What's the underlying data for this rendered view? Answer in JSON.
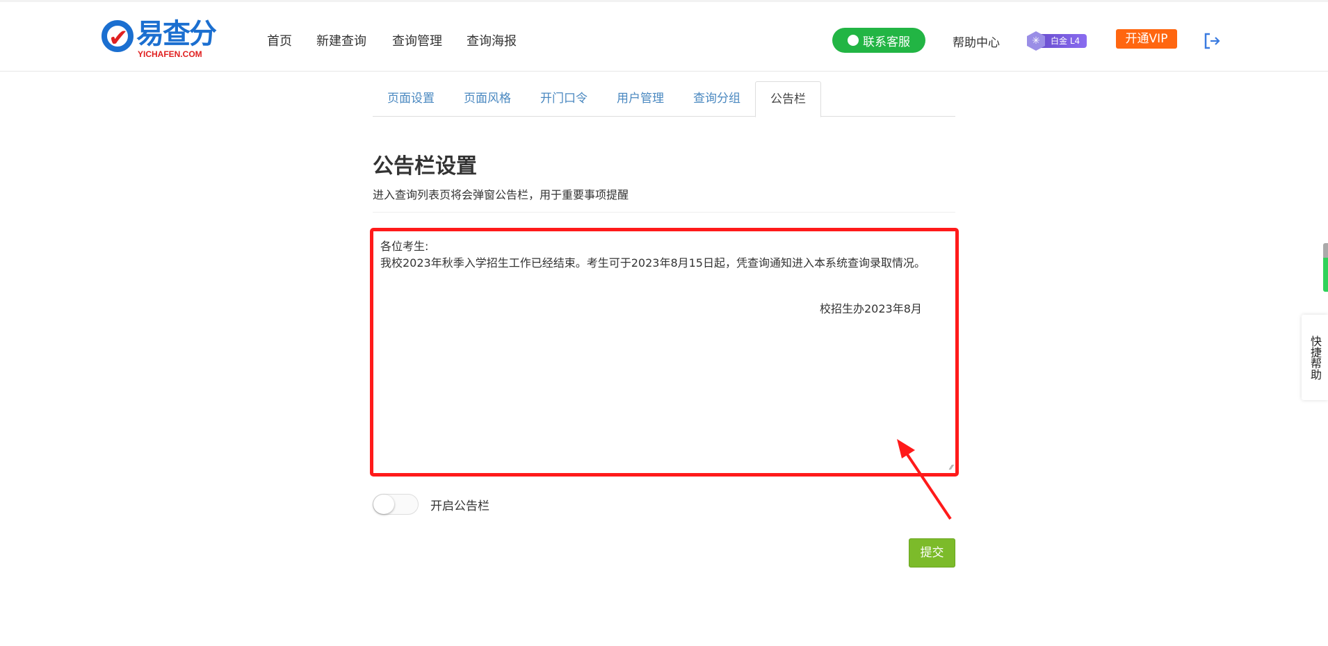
{
  "header": {
    "logo": {
      "cn": "易查分",
      "en": "YICHAFEN.COM"
    },
    "nav": [
      "首页",
      "新建查询",
      "查询管理",
      "查询海报"
    ],
    "service_button": "联系客服",
    "help": "帮助中心",
    "level_badge": "白金 L4",
    "vip_button": "开通VIP"
  },
  "tabs": [
    {
      "label": "页面设置",
      "active": false
    },
    {
      "label": "页面风格",
      "active": false
    },
    {
      "label": "开门口令",
      "active": false
    },
    {
      "label": "用户管理",
      "active": false
    },
    {
      "label": "查询分组",
      "active": false
    },
    {
      "label": "公告栏",
      "active": true
    }
  ],
  "main": {
    "title": "公告栏设置",
    "description": "进入查询列表页将会弹窗公告栏，用于重要事项提醒",
    "notice_text": "各位考生:\n我校2023年秋季入学招生工作已经结束。考生可于2023年8月15日起，凭查询通知进入本系统查询录取情况。",
    "notice_signature": "校招生办2023年8月",
    "toggle_label": "开启公告栏",
    "toggle_on": false,
    "submit": "提交"
  },
  "side": {
    "quick_help": "快捷帮助"
  },
  "colors": {
    "highlight": "#ff1a1a",
    "submit": "#7cbb2a",
    "service": "#22b544",
    "vip": "#ff6610",
    "tab_link": "#4a88c0"
  }
}
